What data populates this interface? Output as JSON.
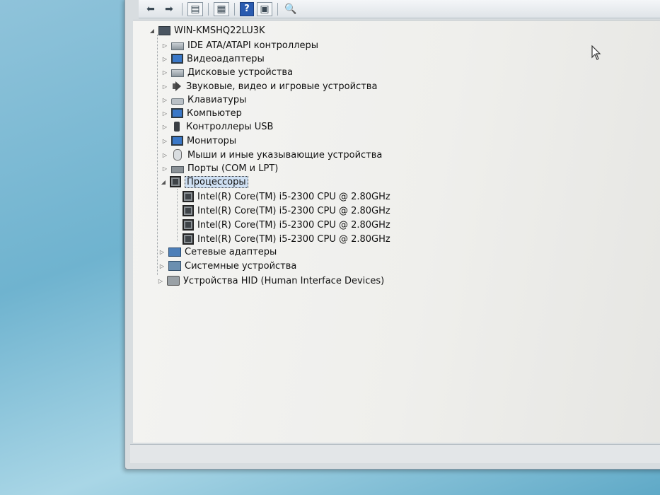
{
  "toolbar": {
    "buttons": [
      {
        "icon": "back-arrow-icon",
        "glyph": "⬅"
      },
      {
        "icon": "forward-arrow-icon",
        "glyph": "➡"
      },
      {
        "icon": "properties-icon",
        "glyph": "▤"
      },
      {
        "icon": "list-view-icon",
        "glyph": "▦"
      },
      {
        "icon": "help-icon",
        "glyph": "?"
      },
      {
        "icon": "update-driver-icon",
        "glyph": "▣"
      },
      {
        "icon": "scan-hardware-icon",
        "glyph": "🔍"
      }
    ]
  },
  "tree": {
    "root": "WIN-KMSHQ22LU3K",
    "categories": [
      {
        "label": "IDE ATA/ATAPI контроллеры",
        "icon": "drive"
      },
      {
        "label": "Видеоадаптеры",
        "icon": "monitor"
      },
      {
        "label": "Дисковые устройства",
        "icon": "drive"
      },
      {
        "label": "Звуковые, видео и игровые устройства",
        "icon": "speaker"
      },
      {
        "label": "Клавиатуры",
        "icon": "kbd"
      },
      {
        "label": "Компьютер",
        "icon": "monitor"
      },
      {
        "label": "Контроллеры USB",
        "icon": "usb"
      },
      {
        "label": "Мониторы",
        "icon": "monitor"
      },
      {
        "label": "Мыши и иные указывающие устройства",
        "icon": "mouse"
      },
      {
        "label": "Порты (COM и LPT)",
        "icon": "port"
      },
      {
        "label": "Процессоры",
        "icon": "cpu",
        "expanded": true,
        "selected": true,
        "children": [
          "Intel(R) Core(TM) i5-2300 CPU @ 2.80GHz",
          "Intel(R) Core(TM) i5-2300 CPU @ 2.80GHz",
          "Intel(R) Core(TM) i5-2300 CPU @ 2.80GHz",
          "Intel(R) Core(TM) i5-2300 CPU @ 2.80GHz"
        ]
      },
      {
        "label": "Сетевые адаптеры",
        "icon": "net"
      },
      {
        "label": "Системные устройства",
        "icon": "sys"
      },
      {
        "label": "Устройства HID (Human Interface Devices)",
        "icon": "hid"
      }
    ]
  },
  "colors": {
    "selection": "#cfe0f3",
    "desktop": "#6fb3cf",
    "tree_background": "#efefec"
  }
}
